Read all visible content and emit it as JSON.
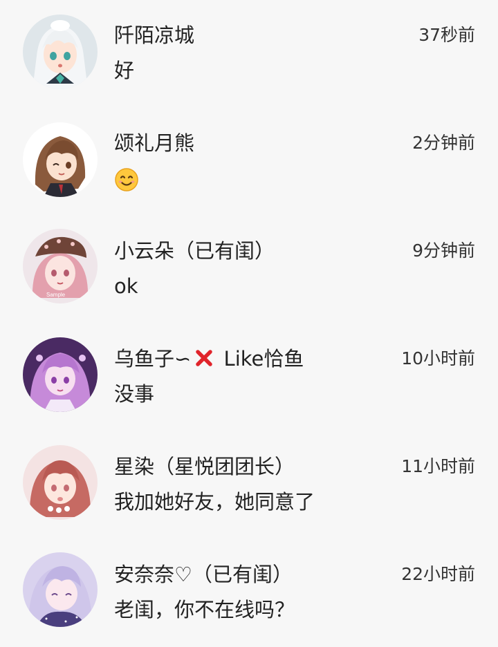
{
  "conversations": [
    {
      "name": "阡陌凉城",
      "time": "37秒前",
      "message": "好",
      "avatar_icon": "anime-girl-white-hair-avatar"
    },
    {
      "name": "颂礼月熊",
      "time": "2分钟前",
      "message": "",
      "message_emoji": "smiling-face-emoji",
      "avatar_icon": "anime-girl-brown-hair-wink-avatar"
    },
    {
      "name": "小云朵（已有闺）",
      "time": "9分钟前",
      "message": "ok",
      "avatar_icon": "anime-girl-pink-hair-beret-avatar"
    },
    {
      "name_prefix": "乌鱼子∽",
      "name_icon": "cross-mark-emoji",
      "name_suffix": " Like恰鱼",
      "time": "10小时前",
      "message": "没事",
      "avatar_icon": "anime-girl-purple-hair-avatar"
    },
    {
      "name": "星染（星悦团团长）",
      "time": "11小时前",
      "message": "我加她好友，她同意了",
      "avatar_icon": "anime-girl-red-hair-avatar"
    },
    {
      "name": "安奈奈♡（已有闺）",
      "time": "22小时前",
      "message": "老闺，你不在线吗？",
      "avatar_icon": "anime-girl-lavender-hair-avatar"
    }
  ],
  "colors": {
    "background": "#f7f7f7",
    "text": "#222222",
    "cross_mark": "#e0242b",
    "emoji_face": "#ffc83d"
  }
}
